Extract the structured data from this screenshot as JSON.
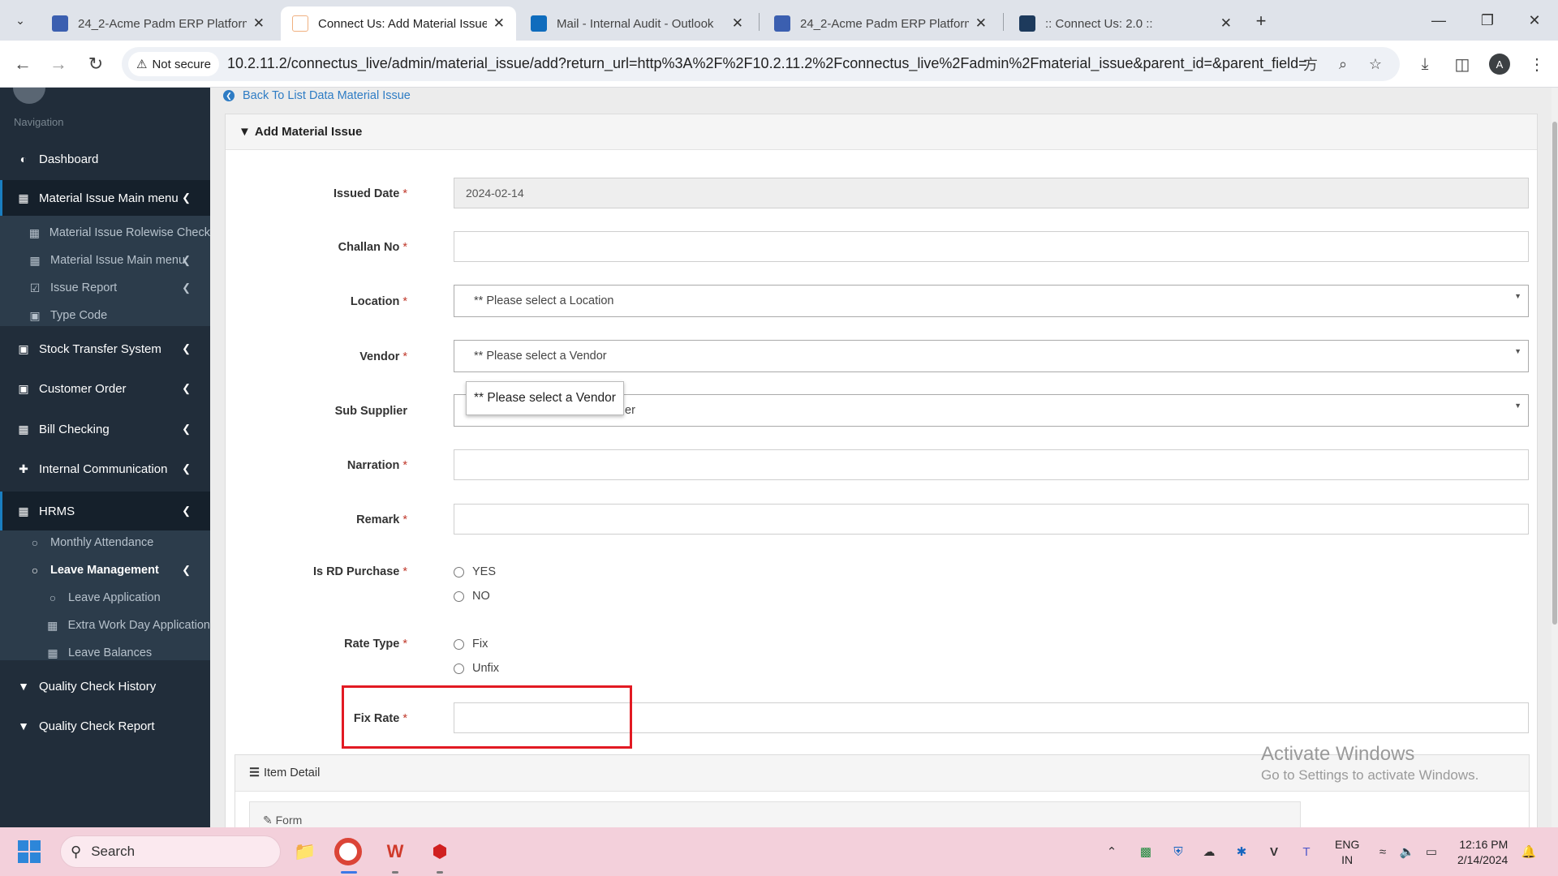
{
  "browser": {
    "tabs": [
      {
        "title": "24_2-Acme Padm ERP Platform"
      },
      {
        "title": "Connect Us: Add Material Issue"
      },
      {
        "title": "Mail - Internal Audit - Outlook"
      },
      {
        "title": "24_2-Acme Padm ERP Platform"
      },
      {
        "title": ":: Connect Us: 2.0 ::"
      }
    ],
    "secure_label": "Not secure",
    "url": "10.2.11.2/connectus_live/admin/material_issue/add?return_url=http%3A%2F%2F10.2.11.2%2Fconnectus_live%2Fadmin%2Fmaterial_issue&parent_id=&parent_field=",
    "profile_initial": "A"
  },
  "sidebar": {
    "heading": "Navigation",
    "dashboard": "Dashboard",
    "material_issue_main": "Material Issue Main menu",
    "sub_rolewise": "Material Issue Rolewise Check",
    "sub_main_menu": "Material Issue Main menu",
    "sub_issue_report": "Issue Report",
    "sub_type_code": "Type Code",
    "stock_transfer": "Stock Transfer System",
    "customer_order": "Customer Order",
    "bill_checking": "Bill Checking",
    "internal_communication": "Internal Communication",
    "hrms": "HRMS",
    "monthly_attendance": "Monthly Attendance",
    "leave_management": "Leave Management",
    "leave_application": "Leave Application",
    "extra_work_day": "Extra Work Day Application",
    "leave_balances": "Leave Balances",
    "quality_check_history": "Quality Check History",
    "quality_check_report": "Quality Check Report"
  },
  "content": {
    "back_link": "Back To List Data Material Issue",
    "panel_title": "Add Material Issue",
    "form": {
      "issued_date_label": "Issued Date",
      "issued_date_value": "2024-02-14",
      "challan_label": "Challan No",
      "location_label": "Location",
      "location_value": "** Please select a Location",
      "vendor_label": "Vendor",
      "vendor_value": "** Please select a Vendor",
      "sub_supplier_label": "Sub Supplier",
      "sub_supplier_value_tail": "er",
      "narration_label": "Narration",
      "remark_label": "Remark",
      "rd_purchase_label": "Is RD Purchase",
      "rd_yes": "YES",
      "rd_no": "NO",
      "rate_type_label": "Rate Type",
      "rate_fix": "Fix",
      "rate_unfix": "Unfix",
      "fix_rate_label": "Fix Rate",
      "required_mark": "*"
    },
    "tooltip": "** Please select a Vendor",
    "item_detail_title": "Item Detail",
    "form_sub_title": "Form"
  },
  "watermark": {
    "title": "Activate Windows",
    "subtitle": "Go to Settings to activate Windows."
  },
  "taskbar": {
    "search_label": "Search",
    "lang_line1": "ENG",
    "lang_line2": "IN",
    "time": "12:16 PM",
    "date": "2/14/2024"
  },
  "colors": {
    "sidebar_bg": "#212d3a",
    "accent_blue": "#2e7cc4",
    "required_red": "#c0392b",
    "highlight_red": "#e21a23",
    "taskbar_bg": "#f3d0db"
  }
}
